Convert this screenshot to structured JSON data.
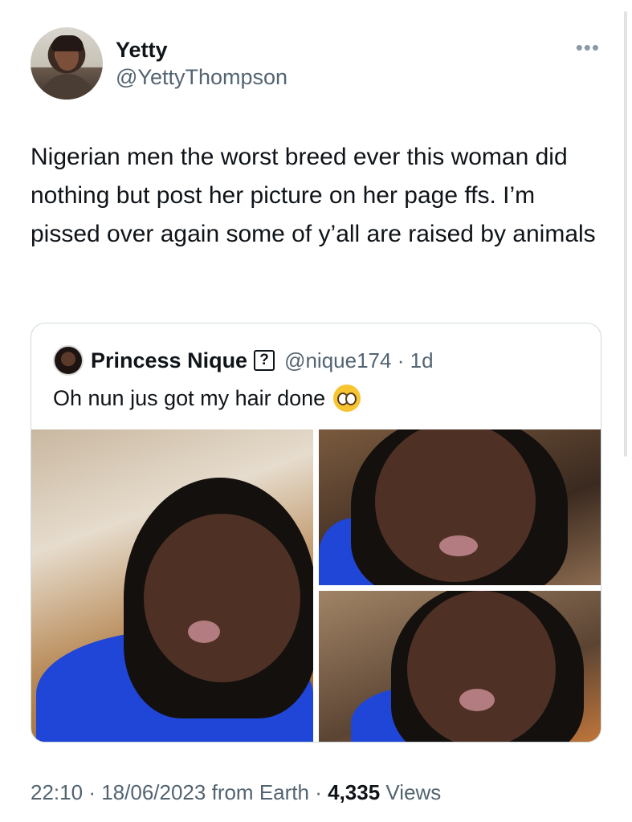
{
  "author": {
    "display_name": "Yetty",
    "handle": "@YettyThompson"
  },
  "more_icon": "more-horizontal-icon",
  "tweet": {
    "text": "Nigerian men the worst breed ever this woman did nothing but post her picture on her page ffs. I’m pissed over again some of y’all are raised by animals"
  },
  "quoted_tweet": {
    "display_name": "Princess Nique",
    "badge": "?",
    "handle": "@nique174",
    "separator": "·",
    "age": "1d",
    "text": "Oh nun jus got my hair done",
    "emoji": "pleading-face-emoji",
    "photo_count": 3
  },
  "meta": {
    "time": "22:10",
    "date": "18/06/2023",
    "source": "from Earth",
    "separator": "·",
    "views_count": "4,335",
    "views_label": "Views"
  },
  "colors": {
    "text_primary": "#0f1419",
    "text_secondary": "#536471",
    "border": "#cfd9de",
    "shirt_blue": "#1f46d6"
  }
}
